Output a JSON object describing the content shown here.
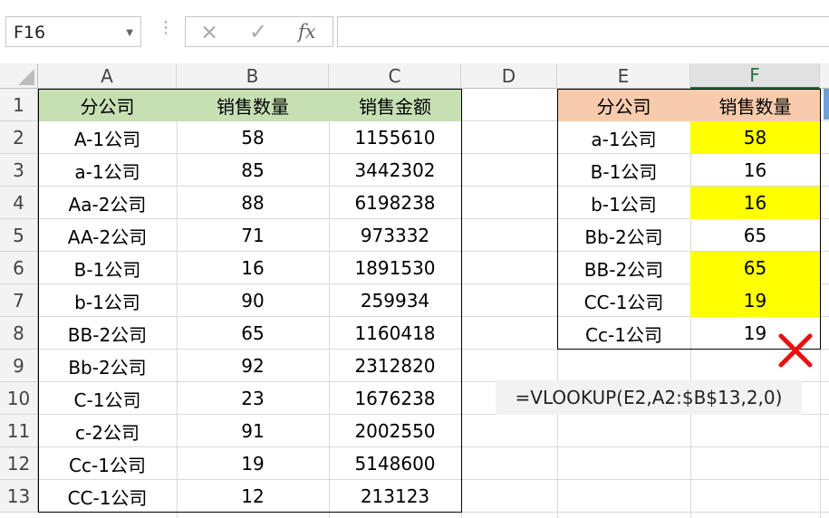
{
  "formula_bar": {
    "name_box": "F16",
    "cancel_icon": "×",
    "enter_icon": "✓",
    "fx_label": "fx",
    "formula": ""
  },
  "columns": [
    "A",
    "B",
    "C",
    "D",
    "E",
    "F"
  ],
  "selected_column": "F",
  "rows": [
    "1",
    "2",
    "3",
    "4",
    "5",
    "6",
    "7",
    "8",
    "9",
    "10",
    "11",
    "12",
    "13"
  ],
  "left_table": {
    "headers": [
      "分公司",
      "销售数量",
      "销售金额"
    ],
    "rows": [
      [
        "A-1公司",
        "58",
        "1155610"
      ],
      [
        "a-1公司",
        "85",
        "3442302"
      ],
      [
        "Aa-2公司",
        "88",
        "6198238"
      ],
      [
        "AA-2公司",
        "71",
        "973332"
      ],
      [
        "B-1公司",
        "16",
        "1891530"
      ],
      [
        "b-1公司",
        "90",
        "259934"
      ],
      [
        "BB-2公司",
        "65",
        "1160418"
      ],
      [
        "Bb-2公司",
        "92",
        "2312820"
      ],
      [
        "C-1公司",
        "23",
        "1676238"
      ],
      [
        "c-2公司",
        "91",
        "2002550"
      ],
      [
        "Cc-1公司",
        "19",
        "5148600"
      ],
      [
        "CC-1公司",
        "12",
        "213123"
      ]
    ]
  },
  "right_table": {
    "headers": [
      "分公司",
      "销售数量"
    ],
    "rows": [
      [
        "a-1公司",
        "58"
      ],
      [
        "B-1公司",
        "16"
      ],
      [
        "b-1公司",
        "16"
      ],
      [
        "Bb-2公司",
        "65"
      ],
      [
        "BB-2公司",
        "65"
      ],
      [
        "CC-1公司",
        "19"
      ],
      [
        "Cc-1公司",
        "19"
      ]
    ],
    "highlight_rows": [
      0,
      2,
      4,
      5
    ]
  },
  "formula_note": "=VLOOKUP(E2,A2:$B$13,2,0)",
  "wrong_mark": "cross-mark-icon",
  "colors": {
    "header_green": "#c6e0b4",
    "header_orange": "#f8cbad",
    "highlight": "#ffff00",
    "wrong_mark": "#e81010"
  }
}
